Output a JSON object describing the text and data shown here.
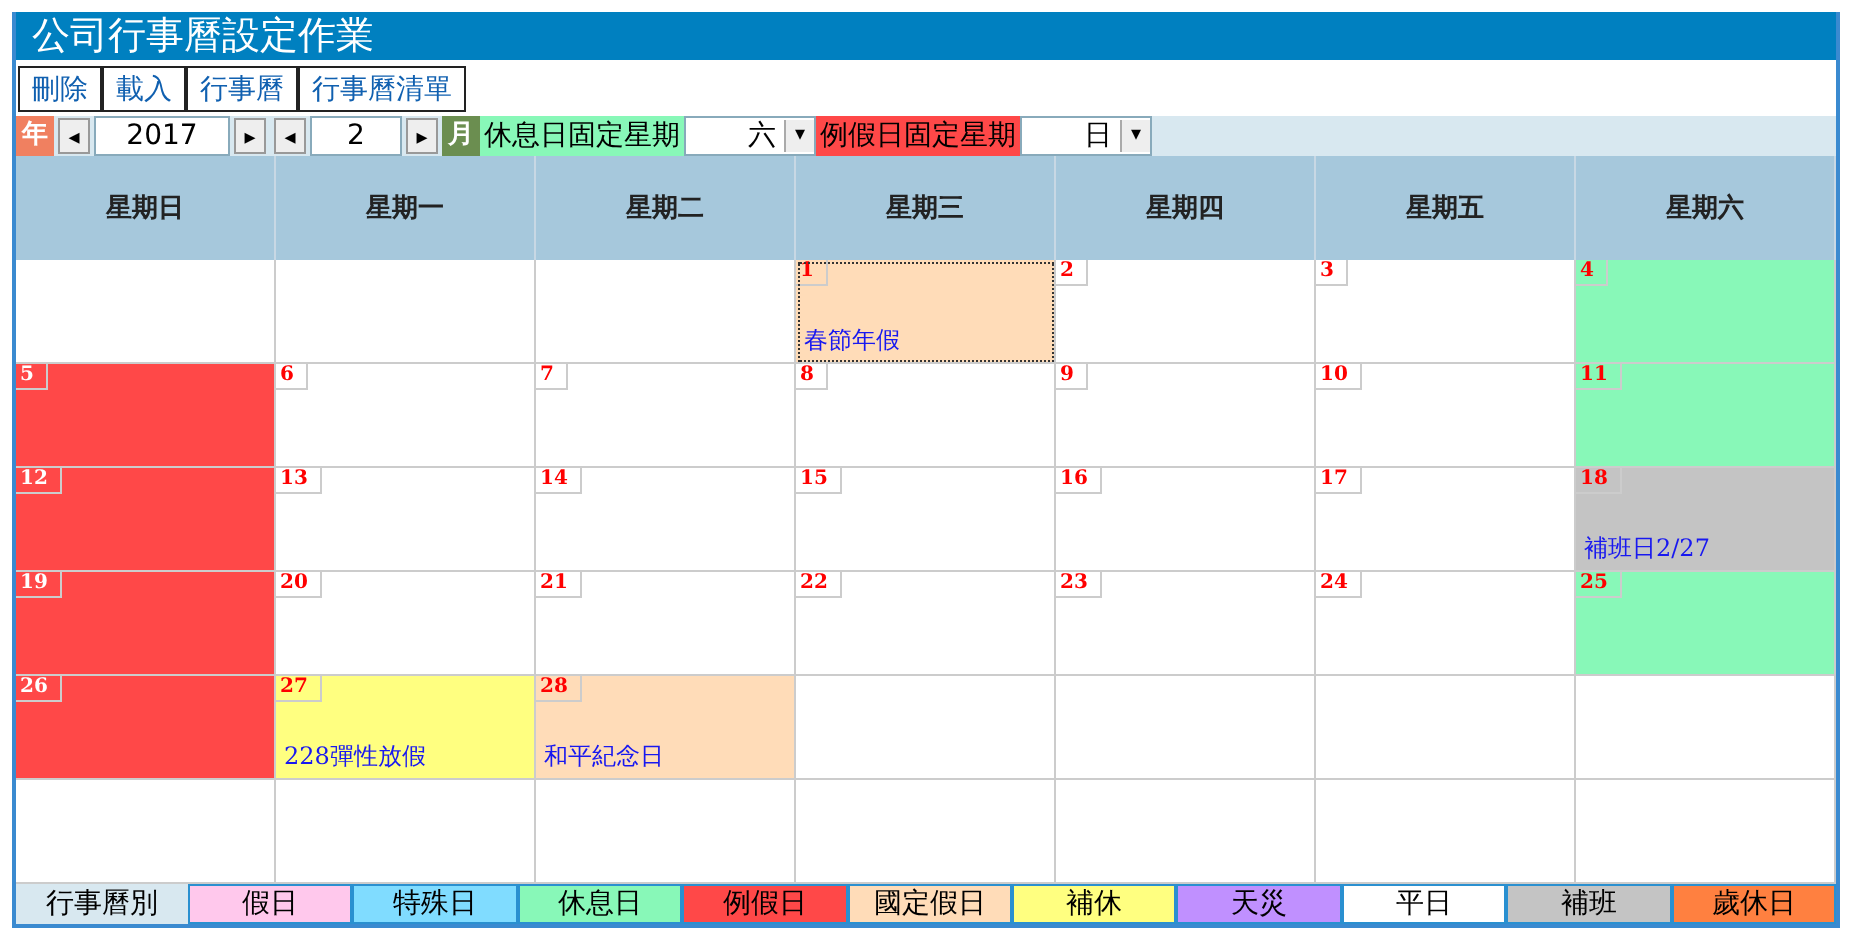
{
  "window": {
    "title": "公司行事曆設定作業"
  },
  "toolbar": [
    "刪除",
    "載入",
    "行事曆",
    "行事曆清單"
  ],
  "controls": {
    "year_badge": "年",
    "year_prev": "◂",
    "year": "2017",
    "year_next": "▸",
    "month_prev": "◂",
    "month": "2",
    "month_next": "▸",
    "month_badge": "月",
    "rest_label": "休息日固定星期",
    "rest_value": "六",
    "rest_caret": "▾",
    "regular_label": "例假日固定星期",
    "regular_value": "日",
    "regular_caret": "▾"
  },
  "weekdays": [
    "星期日",
    "星期一",
    "星期二",
    "星期三",
    "星期四",
    "星期五",
    "星期六"
  ],
  "weeks": [
    {
      "kind": "first",
      "days": [
        {
          "day": "1",
          "color": "#ffdcb8",
          "note": "春節年假",
          "selected": true
        },
        {
          "day": "2",
          "color": "#ffffff",
          "selected": false
        },
        {
          "day": "3",
          "color": "#ffffff",
          "selected": false
        },
        {
          "day": "4",
          "color": "#88f8b8",
          "selected": false
        }
      ]
    },
    {
      "kind": "regular",
      "days": [
        {
          "day": "5",
          "color": "#ff4848",
          "selected": false
        },
        {
          "day": "6",
          "color": "#ffffff",
          "selected": false
        },
        {
          "day": "7",
          "color": "#ffffff",
          "selected": false
        },
        {
          "day": "8",
          "color": "#ffffff",
          "selected": false
        },
        {
          "day": "9",
          "color": "#ffffff",
          "selected": false
        },
        {
          "day": "10",
          "color": "#ffffff",
          "selected": false
        },
        {
          "day": "11",
          "color": "#88f8b8",
          "selected": false
        }
      ]
    },
    {
      "kind": "regular",
      "days": [
        {
          "day": "12",
          "color": "#ff4848",
          "selected": false
        },
        {
          "day": "13",
          "color": "#ffffff",
          "selected": false
        },
        {
          "day": "14",
          "color": "#ffffff",
          "selected": false
        },
        {
          "day": "15",
          "color": "#ffffff",
          "selected": false
        },
        {
          "day": "16",
          "color": "#ffffff",
          "selected": false
        },
        {
          "day": "17",
          "color": "#ffffff",
          "selected": false
        },
        {
          "day": "18",
          "color": "#c4c4c4",
          "note": "補班日2/27",
          "selected": false
        }
      ]
    },
    {
      "kind": "regular",
      "days": [
        {
          "day": "19",
          "color": "#ff4848",
          "selected": false
        },
        {
          "day": "20",
          "color": "#ffffff",
          "selected": false
        },
        {
          "day": "21",
          "color": "#ffffff",
          "selected": false
        },
        {
          "day": "22",
          "color": "#ffffff",
          "selected": false
        },
        {
          "day": "23",
          "color": "#ffffff",
          "selected": false
        },
        {
          "day": "24",
          "color": "#ffffff",
          "selected": false
        },
        {
          "day": "25",
          "color": "#88f8b8",
          "selected": false
        }
      ]
    },
    {
      "kind": "last",
      "days": [
        {
          "day": "26",
          "color": "#ff4848",
          "selected": false
        },
        {
          "day": "27",
          "color": "#ffff80",
          "note": "228彈性放假",
          "selected": false
        },
        {
          "day": "28",
          "color": "#ffdcb8",
          "note": "和平紀念日",
          "selected": false
        }
      ]
    }
  ],
  "legend": {
    "title": "行事曆別",
    "items": [
      {
        "label": "假日",
        "color": "#ffc8ec"
      },
      {
        "label": "特殊日",
        "color": "#80dcff"
      },
      {
        "label": "休息日",
        "color": "#88f8b8"
      },
      {
        "label": "例假日",
        "color": "#ff4848"
      },
      {
        "label": "國定假日",
        "color": "#ffdcb8"
      },
      {
        "label": "補休",
        "color": "#ffff80"
      },
      {
        "label": "天災",
        "color": "#c090ff"
      },
      {
        "label": "平日",
        "color": "#ffffff"
      },
      {
        "label": "補班",
        "color": "#c4c4c4"
      },
      {
        "label": "歲休日",
        "color": "#ff8040"
      }
    ]
  }
}
